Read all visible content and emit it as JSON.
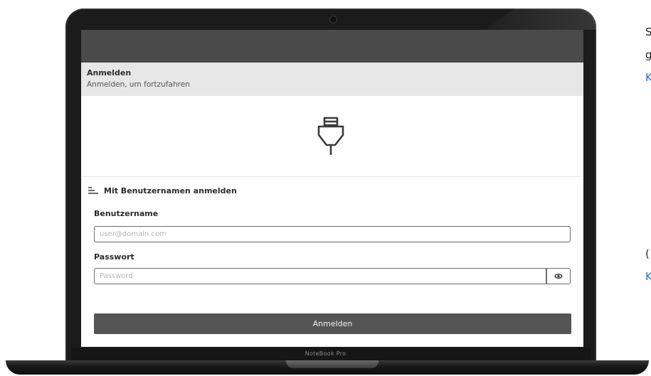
{
  "device": {
    "brand_label": "NoteBook Pro"
  },
  "login": {
    "header_title": "Anmelden",
    "header_subtitle": "Anmelden, um fortzufahren",
    "logo_icon": "plug-icon",
    "method_label": "Mit Benutzernamen anmelden",
    "username_label": "Benutzername",
    "username_placeholder": "user@domain.com",
    "username_value": "",
    "password_label": "Passwort",
    "password_placeholder": "Password",
    "password_value": "",
    "reveal_icon": "eye-icon",
    "submit_label": "Anmelden"
  },
  "side_text": {
    "line1": "S",
    "line2": "g",
    "line3": "K",
    "line4": "(",
    "line5": "K"
  },
  "colors": {
    "topbar": "#4a4a4a",
    "header": "#e7e7e7",
    "submit": "#555555",
    "link": "#2f6fd6"
  }
}
